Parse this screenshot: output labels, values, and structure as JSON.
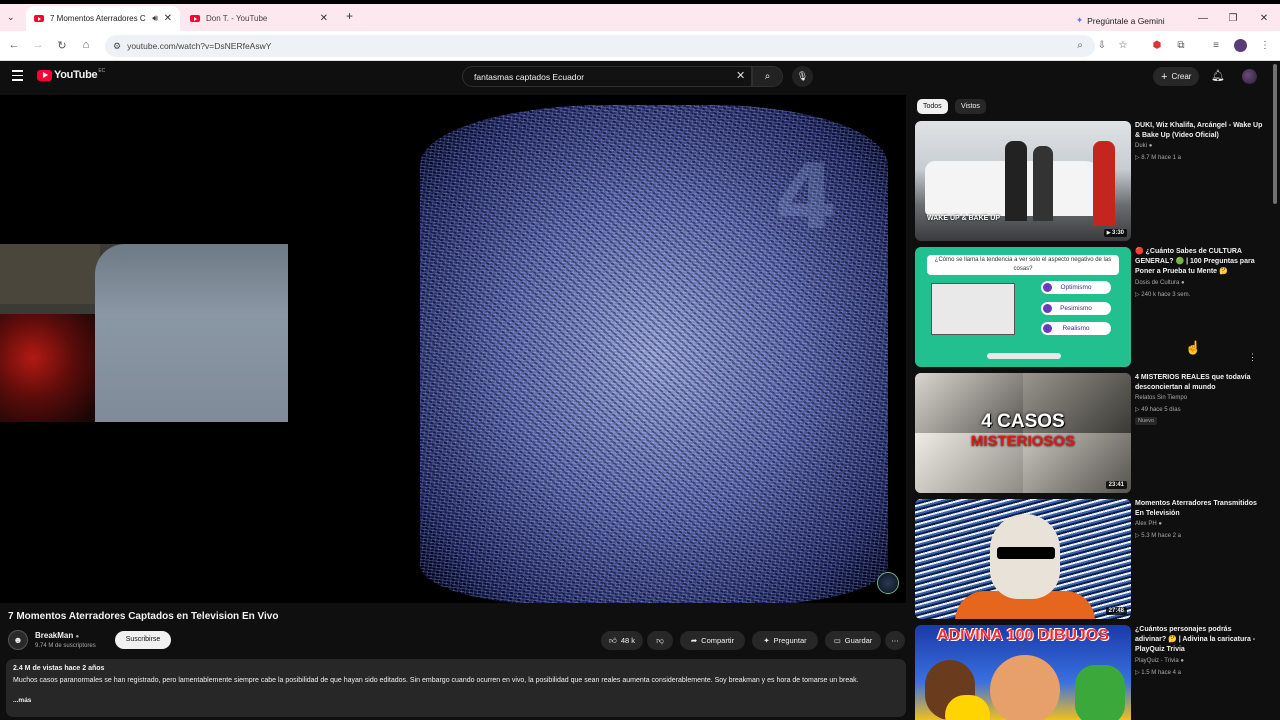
{
  "browser": {
    "tabs": [
      {
        "title": "7 Momentos Aterradores C"
      },
      {
        "title": "Don T. - YouTube"
      }
    ],
    "gemini_label": "Pregúntale a Gemini",
    "url": "youtube.com/watch?v=DsNERfeAswY"
  },
  "header": {
    "logo_text": "YouTube",
    "region": "EC",
    "search_value": "fantasmas captados Ecuador",
    "create_label": "Crear"
  },
  "player": {
    "overlay_digit": "4"
  },
  "video": {
    "title": "7 Momentos Aterradores Captados en Television En Vivo",
    "channel": "BreakMan",
    "subscribers": "9.74 M de suscriptores",
    "subscribe_label": "Suscribirse",
    "likes": "48 k",
    "share_label": "Compartir",
    "ask_label": "Preguntar",
    "save_label": "Guardar",
    "views_time": "2.4 M de vistas  hace 2 años",
    "description": "Muchos casos paranormales se han registrado, pero lamentablemente siempre cabe la posibilidad de que hayan sido editados. Sin embargo cuando ocurren en vivo, la posibilidad que sean reales aumenta considerablemente. Soy breakman y es hora de tomarse un break.",
    "more_label": "...más"
  },
  "sidebar": {
    "chips": [
      "Todos",
      "Vistos"
    ],
    "items": [
      {
        "title": "DUKI, Wiz Khalifa, Arcángel - Wake Up & Bake Up (Video Oficial)",
        "channel": "Duki",
        "stats": "8.7 M  hace 1 a",
        "duration": "3:30",
        "thumb_caption": "WAKE UP & BAKE UP"
      },
      {
        "title": "🔴 ¿Cuánto Sabes de CULTURA GENERAL? 🟢 | 100 Preguntas para Poner a Prueba tu Mente 🤔",
        "channel": "Dosis de Cultura",
        "stats": "240 k  hace 3 sem.",
        "thumb_question": "¿Cómo se llama la tendencia a ver solo el aspecto negativo de las cosas?",
        "options": [
          "Optimismo",
          "Pesimismo",
          "Realismo"
        ]
      },
      {
        "title": "4 MISTERIOS REALES que todavía desconciertan al mundo",
        "channel": "Relatos Sin Tiempo",
        "stats": "49  hace 5 días",
        "badge": "Nuevo",
        "duration": "23:41",
        "thumb_big": "4 CASOS",
        "thumb_sub": "MISTERIOSOS"
      },
      {
        "title": "Momentos Aterradores Transmitidos En Televisión",
        "channel": "Alex PH",
        "stats": "5.3 M  hace 2 a",
        "duration": "27:48"
      },
      {
        "title": "¿Cuántos personajes podrás adivinar? 🤔 | Adivina la caricatura - PlayQuiz Trivia",
        "channel": "PlayQuiz - Trivia",
        "stats": "1.5 M  hace 4 a",
        "thumb_text": "ADIVINA 100 DIBUJOS"
      }
    ]
  },
  "colors": {
    "yt_red": "#ff0033",
    "background": "#0f0f0f",
    "pill": "#272727"
  }
}
